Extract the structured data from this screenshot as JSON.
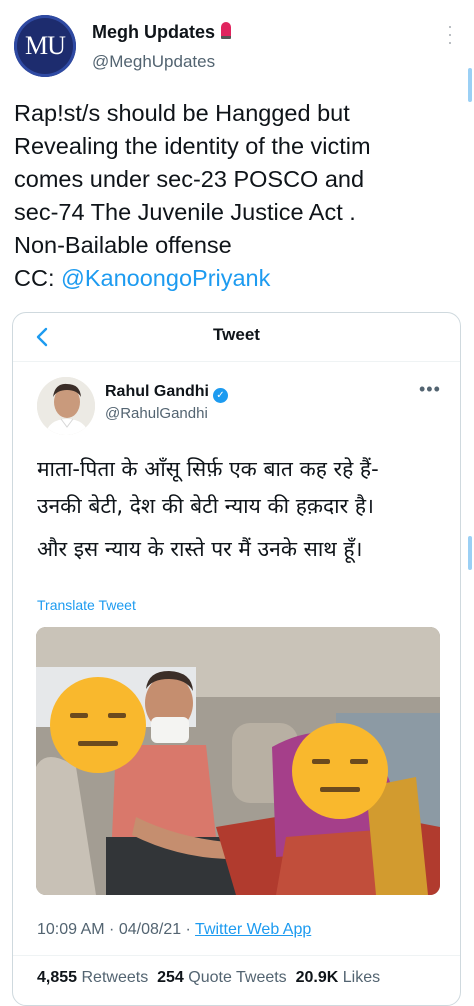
{
  "outer_tweet": {
    "avatar_text": "MU",
    "display_name": "Megh Updates",
    "handle": "@MeghUpdates",
    "text_lines": [
      "Rap!st/s should be Hangged but",
      "Revealing the identity of the victim",
      "comes under sec-23 POSCO and",
      "sec-74 The Juvenile Justice Act .",
      "Non-Bailable offense"
    ],
    "cc_label": "CC: ",
    "mention": "@KanoongoPriyank"
  },
  "quoted": {
    "header_title": "Tweet",
    "display_name": "Rahul Gandhi",
    "handle": "@RahulGandhi",
    "text_lines": [
      "माता-पिता के आँसू सिर्फ़ एक बात कह रहे हैं-",
      "उनकी बेटी, देश की बेटी न्याय की हक़दार है।",
      "और इस न्याय के रास्ते पर मैं उनके साथ हूँ।"
    ],
    "translate_label": "Translate Tweet",
    "time": "10:09 AM",
    "date": "04/08/21",
    "app": "Twitter Web App",
    "stats": {
      "retweets_count": "4,855",
      "retweets_label": "Retweets",
      "quote_count": "254",
      "quote_label": "Quote Tweets",
      "likes_count": "20.9K",
      "likes_label": "Likes"
    }
  },
  "colors": {
    "link": "#1d9bf0",
    "muted": "#536471",
    "border": "#cfd9de",
    "avatar_bg": "#1d2c6e"
  },
  "icons": [
    "siren-emoji-icon",
    "more-vertical-icon",
    "back-chevron-icon",
    "verified-badge-icon",
    "more-horizontal-icon",
    "expressionless-face-emoji-icon"
  ]
}
